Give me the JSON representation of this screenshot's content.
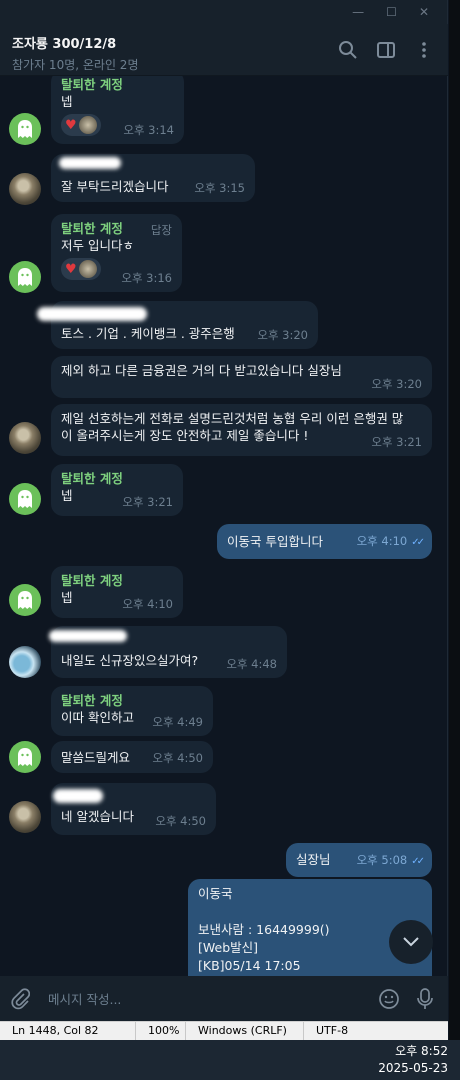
{
  "window": {
    "minimize": "—",
    "maximize": "☐",
    "close": "✕"
  },
  "header": {
    "title": "조자룡 300/12/8",
    "subtitle": "참가자 10명, 온라인 2명"
  },
  "messages": [
    {
      "name": "탈퇴한 계정",
      "text": "넵",
      "time": "오후 3:14"
    },
    {
      "text": "잘 부탁드리겠습니다",
      "time": "오후 3:15"
    },
    {
      "name": "탈퇴한 계정",
      "reply": "답장",
      "text": "저두 입니다ㅎ",
      "time": "오후 3:16"
    },
    {
      "text": "토스 . 기업 . 케이뱅크 . 광주은행",
      "time": "오후 3:20"
    },
    {
      "text": "제외 하고 다른 금융권은 거의 다 받고있습니다 실장님",
      "time": "오후 3:20"
    },
    {
      "text": "제일 선호하는게 전화로 설명드린것처럼 농협 우리 이런 은행권 많이 올려주시는게 장도 안전하고 제일 좋습니다 !",
      "time": "오후 3:21"
    },
    {
      "name": "탈퇴한 계정",
      "text": "넵",
      "time": "오후 3:21"
    },
    {
      "text": "이동국 투입합니다",
      "time": "오후 4:10"
    },
    {
      "name": "탈퇴한 계정",
      "text": "넵",
      "time": "오후 4:10"
    },
    {
      "text": "내일도 신규장있으실가여?",
      "time": "오후 4:48"
    },
    {
      "name": "탈퇴한 계정",
      "text": "이따 확인하고",
      "time": "오후 4:49"
    },
    {
      "text": "말씀드릴게요",
      "time": "오후 4:50"
    },
    {
      "text": "네 알겠습니다",
      "time": "오후 4:50"
    },
    {
      "text": "실장님",
      "time": "오후 5:08"
    },
    {
      "line1": "이동국",
      "line2": "보낸사람 : 16449999()",
      "line3": "[Web발신]",
      "line4": "[KB]05/14 17:05"
    }
  ],
  "input": {
    "placeholder": "메시지 작성..."
  },
  "status": {
    "pos": "Ln 1448, Col 82",
    "zoom": "100%",
    "eol": "Windows (CRLF)",
    "enc": "UTF-8"
  },
  "taskbar": {
    "time": "오후 8:52",
    "date": "2025-05-23"
  }
}
